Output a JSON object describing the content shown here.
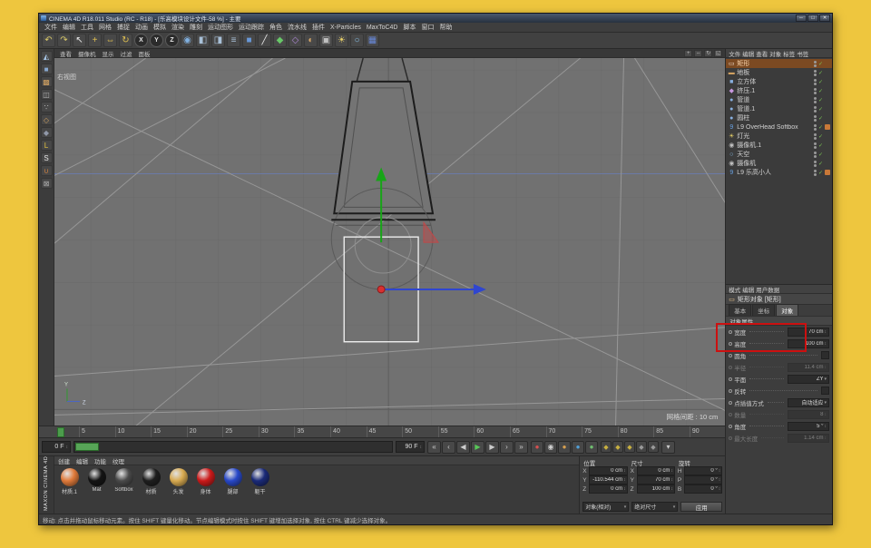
{
  "window": {
    "title": "CINEMA 4D R18.011 Studio (RC - R18) - [乐高模块设计文件-58 %] - 主要",
    "controls": [
      {
        "name": "minimize-button",
        "glyph": "─"
      },
      {
        "name": "maximize-button",
        "glyph": "□"
      },
      {
        "name": "close-button",
        "glyph": "✕"
      }
    ]
  },
  "ui": {
    "check": "✓",
    "caret": "▾",
    "updown": "↕"
  },
  "colors": {
    "highlight_box": "#cc1010",
    "selection_orange": "#7c4a22",
    "viewport_bg": "#717171"
  },
  "menubar": {
    "items": [
      "文件",
      "编辑",
      "工具",
      "网格",
      "捕捉",
      "动画",
      "模拟",
      "渲染",
      "雕刻",
      "运动图形",
      "运动跟踪",
      "角色",
      "流水线",
      "插件",
      "X-Particles",
      "MaxToC4D",
      "脚本",
      "窗口",
      "帮助"
    ]
  },
  "toolbar": {
    "items": [
      {
        "name": "undo-icon",
        "glyph": "↶",
        "color": "#d8c868"
      },
      {
        "name": "redo-icon",
        "glyph": "↷",
        "color": "#d8c868"
      },
      {
        "name": "live-selection-icon",
        "glyph": "↖",
        "color": "#e8e8e8"
      },
      {
        "name": "move-tool-icon",
        "glyph": "+",
        "color": "#e0c050"
      },
      {
        "name": "scale-tool-icon",
        "glyph": "⇔",
        "color": "#e0c050"
      },
      {
        "name": "rotate-tool-icon",
        "glyph": "↻",
        "color": "#e0c050"
      },
      {
        "name": "x-axis-lock-icon",
        "glyph": "X",
        "color": "#e8e8e8",
        "round": "round"
      },
      {
        "name": "y-axis-lock-icon",
        "glyph": "Y",
        "color": "#e8e8e8",
        "round": "round"
      },
      {
        "name": "z-axis-lock-icon",
        "glyph": "Z",
        "color": "#e8e8e8",
        "round": "round"
      },
      {
        "name": "coordinate-system-icon",
        "glyph": "◉",
        "color": "#80b0e0"
      },
      {
        "name": "render-view-icon",
        "glyph": "◧",
        "color": "#a8c0d8"
      },
      {
        "name": "render-to-picture-icon",
        "glyph": "◨",
        "color": "#a8c0d8"
      },
      {
        "name": "render-settings-icon",
        "glyph": "≡",
        "color": "#a8c0d8"
      },
      {
        "name": "cube-primitive-icon",
        "glyph": "■",
        "color": "#6898d8"
      },
      {
        "name": "spline-pen-icon",
        "glyph": "╱",
        "color": "#e8e8e8"
      },
      {
        "name": "generator-icon",
        "glyph": "◆",
        "color": "#68c868"
      },
      {
        "name": "deformer-icon",
        "glyph": "◇",
        "color": "#b088d8"
      },
      {
        "name": "field-icon",
        "glyph": "◐",
        "color": "#d8a868"
      },
      {
        "name": "camera-icon",
        "glyph": "▣",
        "color": "#c0c0c0"
      },
      {
        "name": "light-icon",
        "glyph": "☀",
        "color": "#e8d068"
      },
      {
        "name": "sky-icon",
        "glyph": "○",
        "color": "#88c0e8"
      },
      {
        "name": "cloth-icon",
        "glyph": "▦",
        "color": "#6888d8"
      }
    ]
  },
  "left_toolbar": {
    "items": [
      {
        "name": "make-editable-icon",
        "glyph": "◭",
        "color": "#a8c8e8"
      },
      {
        "name": "model-mode-icon",
        "glyph": "■",
        "color": "#88a8d0"
      },
      {
        "name": "texture-mode-icon",
        "glyph": "▩",
        "color": "#d0a060"
      },
      {
        "name": "workplane-mode-icon",
        "glyph": "◫",
        "color": "#b0b0b0"
      },
      {
        "name": "points-mode-icon",
        "glyph": "∵",
        "color": "#c8c8c8"
      },
      {
        "name": "edges-mode-icon",
        "glyph": "◇",
        "color": "#d0a060"
      },
      {
        "name": "polygons-mode-icon",
        "glyph": "◆",
        "color": "#9098a8"
      },
      {
        "name": "enable-axis-icon",
        "glyph": "L",
        "color": "#e0c040"
      },
      {
        "name": "solo-mode-icon",
        "glyph": "S",
        "color": "#e8e8e8"
      },
      {
        "name": "snap-icon",
        "glyph": "∪",
        "color": "#d08040"
      },
      {
        "name": "lock-workplane-icon",
        "glyph": "⊠",
        "color": "#b0b0b0"
      }
    ]
  },
  "viewport": {
    "menu": [
      "查看",
      "摄像机",
      "显示",
      "过滤",
      "面板"
    ],
    "corner_icons": [
      {
        "name": "viewport-pan-icon",
        "glyph": "+"
      },
      {
        "name": "viewport-zoom-icon",
        "glyph": "⇔"
      },
      {
        "name": "viewport-rotate-icon",
        "glyph": "↻"
      },
      {
        "name": "viewport-toggle-icon",
        "glyph": "◱"
      }
    ],
    "label": "右视图",
    "grid_label": "网格间距 : 10 cm",
    "axis_labels": {
      "vertical": "Y",
      "horizontal": "Z"
    }
  },
  "object_manager": {
    "menu": [
      "文件",
      "编辑",
      "查看",
      "对象",
      "标签",
      "书签"
    ],
    "objects": [
      {
        "label": "矩形",
        "glyph": "▭",
        "color": "#f0e0d0",
        "state": "selected"
      },
      {
        "label": "地板",
        "glyph": "▬",
        "color": "#d0a060"
      },
      {
        "label": "立方体",
        "glyph": "■",
        "color": "#88b0e0"
      },
      {
        "label": "挤压.1",
        "glyph": "◆",
        "color": "#c898e0"
      },
      {
        "label": "管道",
        "glyph": "●",
        "color": "#88b0e0"
      },
      {
        "label": "管道.1",
        "glyph": "●",
        "color": "#88b0e0"
      },
      {
        "label": "圆柱",
        "glyph": "●",
        "color": "#88b0e0"
      },
      {
        "label": "L9 OverHead Softbox",
        "glyph": "9",
        "color": "#68a0e0",
        "tag": "#c87838"
      },
      {
        "label": "灯光",
        "glyph": "☀",
        "color": "#e8d068"
      },
      {
        "label": "摄像机.1",
        "glyph": "◉",
        "color": "#c0c0c0"
      },
      {
        "label": "天空",
        "glyph": "○",
        "color": "#88c0e8"
      },
      {
        "label": "摄像机",
        "glyph": "◉",
        "color": "#c0c0c0"
      },
      {
        "label": "L9 乐高小人",
        "glyph": "9",
        "color": "#68a0e0",
        "tag": "#c87838"
      }
    ]
  },
  "attributes": {
    "menu": [
      "模式",
      "编辑",
      "用户数据"
    ],
    "title": "矩形对象 [矩形]",
    "title_icon": "▭",
    "tabs": [
      {
        "label": "基本"
      },
      {
        "label": "坐标"
      },
      {
        "label": "对象",
        "state": "active"
      }
    ],
    "section": "对象属性",
    "rows": [
      {
        "label": "宽度",
        "value": "70 cm",
        "type": "spin"
      },
      {
        "label": "高度",
        "value": "100 cm",
        "type": "spin"
      },
      {
        "label": "圆角",
        "value": "",
        "type": "check"
      },
      {
        "label": "半径",
        "value": "11.4 cm",
        "type": "spin",
        "state": "disabled"
      },
      {
        "label": "平面",
        "value": "ZY",
        "type": "select"
      },
      {
        "label": "反转",
        "value": "",
        "type": "check"
      },
      {
        "label": "点插值方式",
        "value": "自动适应",
        "type": "select"
      },
      {
        "label": "数量",
        "value": "8",
        "type": "spin",
        "state": "disabled"
      },
      {
        "label": "角度",
        "value": "5 °",
        "type": "spin"
      },
      {
        "label": "最大长度",
        "value": "1.14 cm",
        "type": "spin",
        "state": "disabled"
      }
    ]
  },
  "timeline": {
    "ticks": [
      "5",
      "10",
      "15",
      "20",
      "25",
      "30",
      "35",
      "40",
      "45",
      "50",
      "55",
      "60",
      "65",
      "70",
      "75",
      "80",
      "85",
      "90"
    ],
    "current_frame": "0 F",
    "end_frame": "90 F",
    "transport": [
      {
        "name": "goto-start-button",
        "glyph": "«"
      },
      {
        "name": "prev-key-button",
        "glyph": "‹"
      },
      {
        "name": "prev-frame-button",
        "glyph": "◀"
      },
      {
        "name": "play-button",
        "glyph": "▶",
        "color": "#58c858"
      },
      {
        "name": "next-frame-button",
        "glyph": "▶"
      },
      {
        "name": "next-key-button",
        "glyph": "›"
      },
      {
        "name": "goto-end-button",
        "glyph": "»"
      }
    ],
    "record_buttons": [
      {
        "name": "record-keyframe-button",
        "glyph": "●",
        "color": "#d85050"
      },
      {
        "name": "autokey-button",
        "glyph": "◉",
        "color": "#d0d0d0"
      },
      {
        "name": "record-position-button",
        "glyph": "●",
        "color": "#d8a050"
      },
      {
        "name": "record-scale-button",
        "glyph": "●",
        "color": "#50a0d8"
      },
      {
        "name": "record-rotation-button",
        "glyph": "●",
        "color": "#70c070"
      }
    ],
    "key_toggles": [
      {
        "name": "key-position-toggle",
        "glyph": "◆",
        "color": "#c8b040"
      },
      {
        "name": "key-scale-toggle",
        "glyph": "◆",
        "color": "#c8b040"
      },
      {
        "name": "key-rotation-toggle",
        "glyph": "◆",
        "color": "#c8b040"
      },
      {
        "name": "key-parameter-toggle",
        "glyph": "◆",
        "color": "#9a9a9a"
      },
      {
        "name": "key-pla-toggle",
        "glyph": "◆",
        "color": "#9a9a9a"
      }
    ],
    "options_icon": {
      "name": "keyframe-selection-button",
      "glyph": "▾"
    }
  },
  "materials": {
    "menu": [
      "创建",
      "编辑",
      "功能",
      "纹理"
    ],
    "items": [
      {
        "label": "材质.1",
        "color": "#e07a3a"
      },
      {
        "label": "Mat",
        "color": "#141414"
      },
      {
        "label": "Softbox",
        "color": "#4a4a4a"
      },
      {
        "label": "材质",
        "color": "#1e1e1e"
      },
      {
        "label": "头发",
        "color": "#d8aa50"
      },
      {
        "label": "身体",
        "color": "#cc1a1a"
      },
      {
        "label": "腿部",
        "color": "#2848c8"
      },
      {
        "label": "躯干",
        "color": "#1a2a78"
      }
    ]
  },
  "coordinates": {
    "groups": [
      {
        "title": "位置",
        "rows": [
          {
            "axis": "X",
            "value": "0 cm"
          },
          {
            "axis": "Y",
            "value": "-110.544 cm"
          },
          {
            "axis": "Z",
            "value": "0 cm"
          }
        ]
      },
      {
        "title": "尺寸",
        "rows": [
          {
            "axis": "X",
            "value": "0 cm"
          },
          {
            "axis": "Y",
            "value": "70 cm"
          },
          {
            "axis": "Z",
            "value": "100 cm"
          }
        ]
      },
      {
        "title": "旋转",
        "rows": [
          {
            "axis": "H",
            "value": "0 °"
          },
          {
            "axis": "P",
            "value": "0 °"
          },
          {
            "axis": "B",
            "value": "0 °"
          }
        ]
      }
    ],
    "mode_select": "对象(相对)",
    "size_select": "绝对尺寸",
    "apply_label": "应用"
  },
  "statusbar": {
    "text": "移动: 点击并拖动鼠标移动元素。按住 SHIFT 键量化移动。节点编辑模式时按住 SHIFT 键增加选择对象, 按住 CTRL 键减少选择对象。"
  },
  "brand": {
    "vertical_text": "MAXON CINEMA 4D"
  }
}
